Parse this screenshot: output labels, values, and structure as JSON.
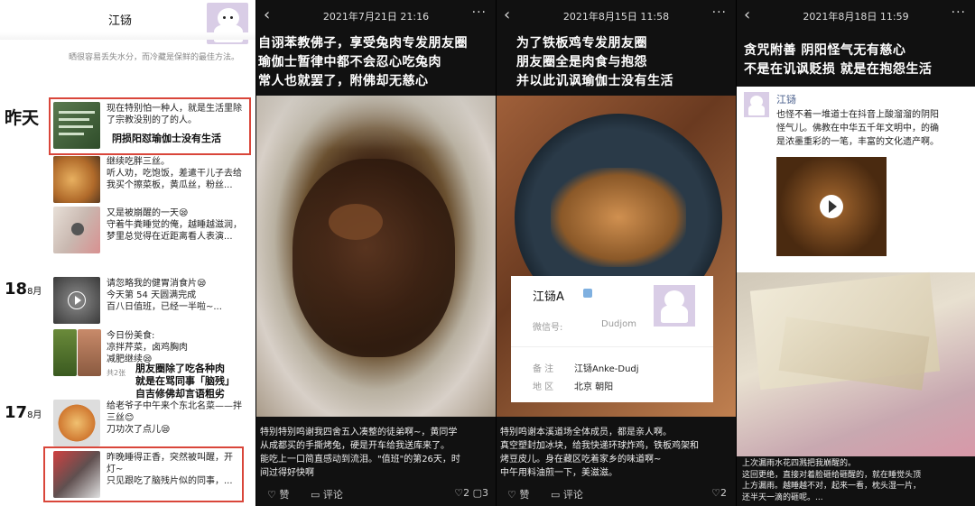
{
  "p1": {
    "name": "江铴",
    "signature": "晒很容易丢失水分，而冷藏是保鲜的最佳方法。",
    "date_yesterday": "昨天",
    "date_18": "18",
    "date_17": "17",
    "month": "8月",
    "post1": [
      "现在特别怕一种人，就是生活里除",
      "了宗教没别的了的人。"
    ],
    "note1": "阴损阳怼瑜伽士没有生活",
    "post2": [
      "继续吃胖三丝。",
      "听人劝，吃饱饭，差遣干儿子去给",
      "我买个擦菜板，黄瓜丝，粉丝..."
    ],
    "post3": [
      "又是被崩醒的一天😪",
      "守着牛粪睡觉的俺，越睡越滋润，",
      "梦里总觉得在近距离看人表演..."
    ],
    "post4": [
      "请忽略我的健胃消食片😪",
      "今天第 54 天圆满完成",
      "百八日值班，已经一半啦~..."
    ],
    "post5": [
      "今日份美食:",
      "凉拌芹菜，卤鸡胸肉",
      "减肥继续😪"
    ],
    "count5": "共2张",
    "note2": [
      "朋友圈除了吃各种肉",
      "就是在骂同事「脑残」",
      "自吉修佛却言语粗劣"
    ],
    "post6": [
      "给老爷子中午来个东北名菜——拌",
      "三丝😊",
      "刀功次了点儿😪"
    ],
    "post7": [
      "昨晚睡得正香，突然被叫醒，开",
      "灯~",
      "只见跟吃了脑残片似的同事，..."
    ]
  },
  "p2": {
    "timestamp": "2021年7月21日 21:16",
    "headline": [
      "自诩苯教佛子，享受兔肉专发朋友圈",
      "瑜伽士暂律中都不会忍心吃兔肉",
      "常人也就罢了，附佛却无慈心"
    ],
    "caption": [
      "特别特别鸣谢我四舍五入凑整的徒弟啊~，黄同学",
      "从成都买的手撕烤兔，硬是开车给我送库来了。",
      "能吃上一口简直感动到流泪。\"值班\"的第26天，时",
      "间过得好快啊"
    ],
    "like": "赞",
    "comment": "评论",
    "counts": "♡2 ▢3"
  },
  "p3": {
    "timestamp": "2021年8月15日 11:58",
    "headline": [
      "为了铁板鸡专发朋友圈",
      "朋友圈全是肉食与抱怨",
      "并以此讥讽瑜伽士没有生活"
    ],
    "card_name": "江铴A",
    "card_id_label": "微信号:",
    "card_id_value": "Dudjom",
    "card_note_label": "备 注",
    "card_note_value": "江铴Anke-Dudj",
    "card_region_label": "地 区",
    "card_region_value": "北京 朝阳",
    "caption": [
      "特别鸣谢本溪道场全体成员，都是亲人啊。",
      "真空塑封加冰块，给我快递环球炸鸡，铁板鸡架和",
      "烤豆皮儿。身在藏区吃着家乡的味道啊~",
      "中午用料油煎一下，美滋滋。"
    ],
    "like": "赞",
    "comment": "评论",
    "counts": "♡2"
  },
  "p4": {
    "timestamp": "2021年8月18日 11:59",
    "headline": [
      "贪咒附善 阴阳怪气无有慈心",
      "不是在讥讽贬损 就是在抱怨生活"
    ],
    "quote_name": "江铴",
    "quote_text": [
      "也怪不着一堆道士在抖音上酸溜溜的阴阳",
      "怪气儿。佛教在中华五千年文明中，的确",
      "是浓墨重彩的一笔，丰富的文化遗产啊。"
    ],
    "caption": [
      "上次漏雨水花四溅把我崩醒的。",
      "这回更绝，直接对着脸砸给砸醒的，就在睡觉头顶",
      "上方漏雨。越睡越不对，起来一看，枕头湿一片，",
      "还半天一滴的砸呢。..."
    ]
  }
}
